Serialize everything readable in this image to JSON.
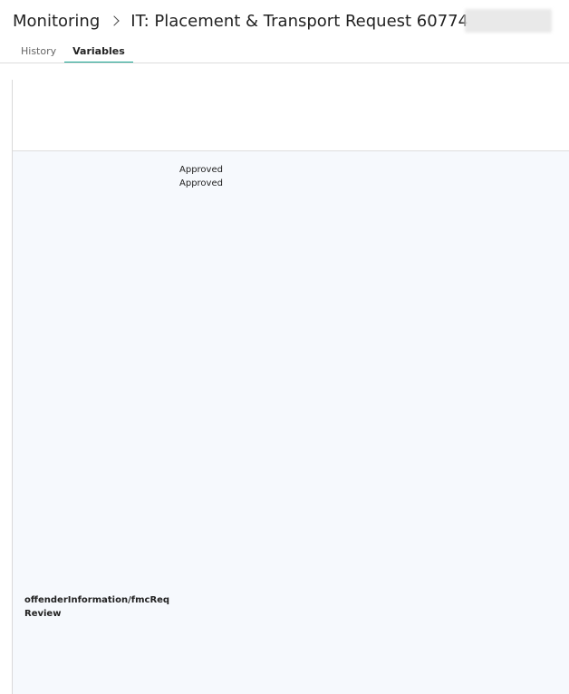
{
  "breadcrumb": {
    "root": "Monitoring",
    "current": "IT: Placement & Transport Request 60774"
  },
  "tabs": [
    {
      "label": "History",
      "active": false
    },
    {
      "label": "Variables",
      "active": true
    }
  ],
  "variables": {
    "values": [
      "Approved",
      "Approved"
    ],
    "name_line1": "offenderInformation/fmcReq",
    "name_line2": "Review"
  },
  "colors": {
    "accent": "#1aa692",
    "panel_bg": "#f6f9fd"
  }
}
